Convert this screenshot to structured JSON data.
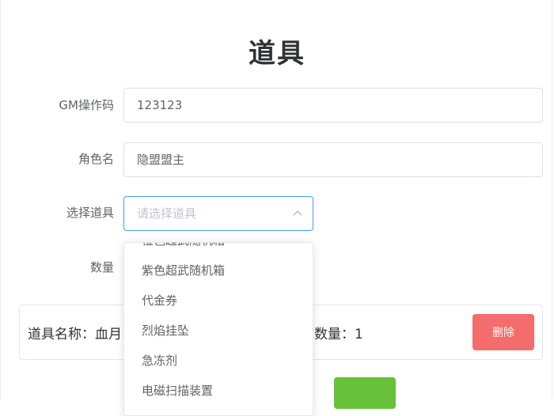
{
  "page": {
    "title": "道具"
  },
  "form": {
    "gm_code": {
      "label": "GM操作码",
      "value": "123123"
    },
    "role_name": {
      "label": "角色名",
      "value": "隐盟盟主"
    },
    "item_select": {
      "label": "选择道具",
      "placeholder": "请选择道具"
    },
    "quantity": {
      "label": "数量"
    }
  },
  "dropdown": {
    "options": [
      "橙色超武随机箱",
      "紫色超武随机箱",
      "代金券",
      "烈焰挂坠",
      "急冻剂",
      "电磁扫描装置"
    ]
  },
  "item_card": {
    "name_text": "道具名称：血月",
    "qty_text": "数量：1",
    "delete_label": "删除"
  },
  "colors": {
    "primary": "#409eff",
    "danger": "#f56c6c",
    "success": "#67c23a"
  }
}
